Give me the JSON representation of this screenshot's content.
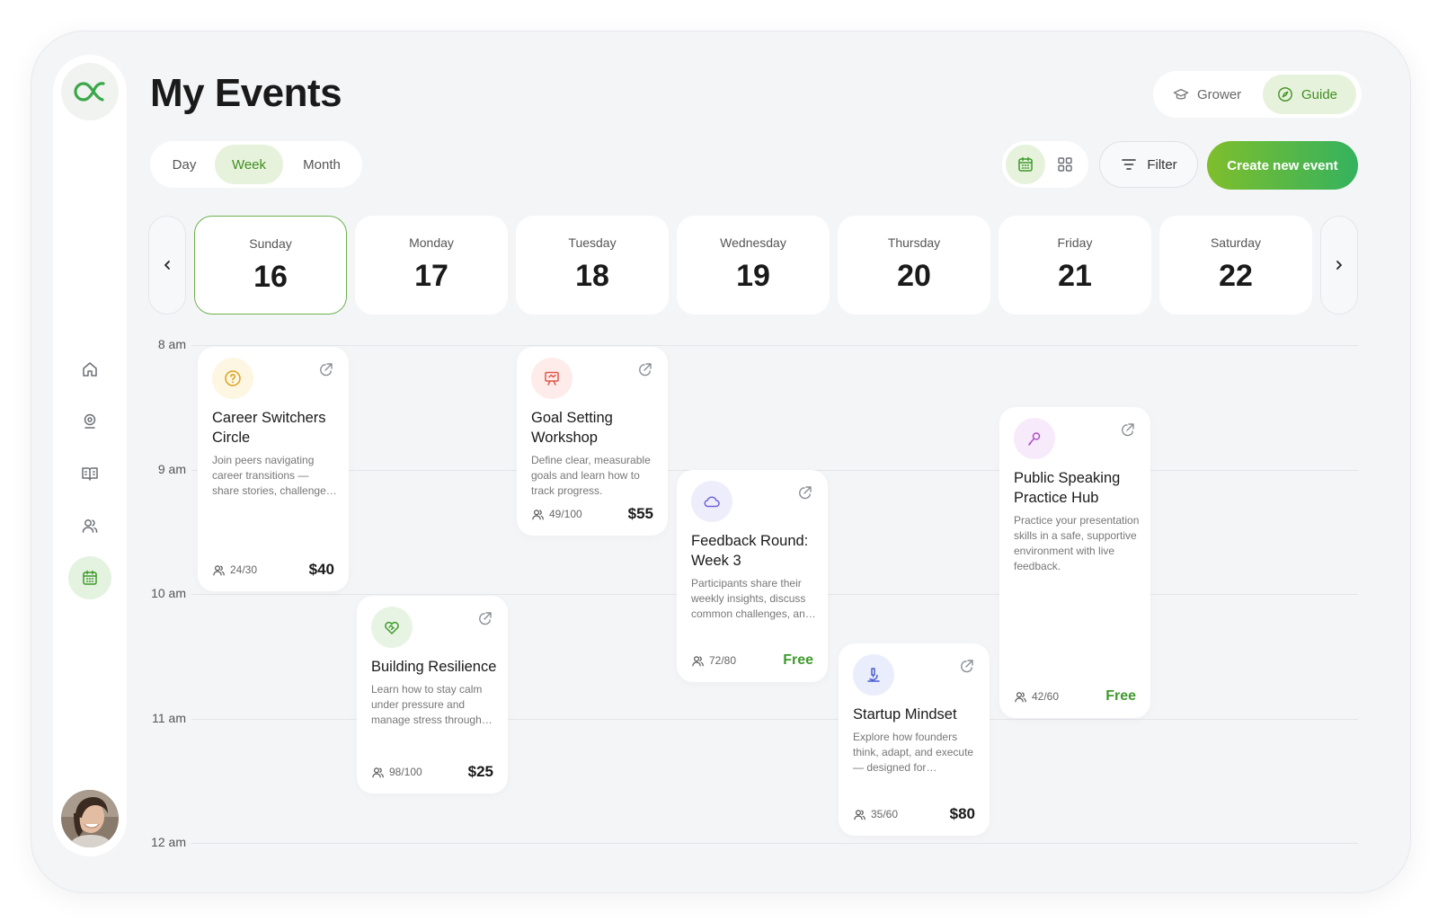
{
  "page": {
    "title": "My Events"
  },
  "roles": [
    {
      "label": "Grower",
      "icon": "graduation-cap-icon",
      "active": false
    },
    {
      "label": "Guide",
      "icon": "compass-icon",
      "active": true
    }
  ],
  "view_tabs": [
    {
      "label": "Day",
      "active": false
    },
    {
      "label": "Week",
      "active": true
    },
    {
      "label": "Month",
      "active": false
    }
  ],
  "layout_toggle": {
    "active": "calendar",
    "options": [
      "calendar-icon",
      "grid-icon"
    ]
  },
  "toolbar": {
    "filter_label": "Filter",
    "create_label": "Create new event"
  },
  "week": {
    "days": [
      {
        "name": "Sunday",
        "date": "16",
        "selected": true
      },
      {
        "name": "Monday",
        "date": "17",
        "selected": false
      },
      {
        "name": "Tuesday",
        "date": "18",
        "selected": false
      },
      {
        "name": "Wednesday",
        "date": "19",
        "selected": false
      },
      {
        "name": "Thursday",
        "date": "20",
        "selected": false
      },
      {
        "name": "Friday",
        "date": "21",
        "selected": false
      },
      {
        "name": "Saturday",
        "date": "22",
        "selected": false
      }
    ]
  },
  "time_labels": [
    "8 am",
    "9 am",
    "10 am",
    "11 am",
    "12 am"
  ],
  "events": [
    {
      "title": "Career Switchers Circle",
      "description": "Join peers navigating career transitions — share stories, challenges and strategies.",
      "attendees": "24/30",
      "price": "$40",
      "icon": "question-circle-icon",
      "icon_color": "#d9a21b",
      "icon_bg": "#fdf6e3"
    },
    {
      "title": "Goal Setting Workshop",
      "description": "Define clear, measurable goals and learn how to track progress.",
      "attendees": "49/100",
      "price": "$55",
      "icon": "presentation-board-icon",
      "icon_color": "#e0564a",
      "icon_bg": "#fdecea"
    },
    {
      "title": "Building Resilience",
      "description": "Learn how to stay calm under pressure and manage stress through practice.",
      "attendees": "98/100",
      "price": "$25",
      "icon": "heart-handshake-icon",
      "icon_color": "#3f9a2c",
      "icon_bg": "#e8f4e3"
    },
    {
      "title": "Feedback Round: Week 3",
      "description": "Participants share their weekly insights, discuss common challenges, and grow.",
      "attendees": "72/80",
      "price": "Free",
      "icon": "cloud-icon",
      "icon_color": "#6d63d6",
      "icon_bg": "#eeedfb"
    },
    {
      "title": "Startup Mindset",
      "description": "Explore how founders think, adapt, and execute — designed for beginners.",
      "attendees": "35/60",
      "price": "$80",
      "icon": "microscope-icon",
      "icon_color": "#4a5fd1",
      "icon_bg": "#eaedfb"
    },
    {
      "title": "Public Speaking Practice Hub",
      "description": "Practice your presentation skills in a safe, supportive environment with live feedback.",
      "attendees": "42/60",
      "price": "Free",
      "icon": "microphone-icon",
      "icon_color": "#b14fc7",
      "icon_bg": "#f7eafa"
    }
  ],
  "sidebar": {
    "items": [
      {
        "icon": "home-icon",
        "active": false
      },
      {
        "icon": "location-pin-icon",
        "active": false
      },
      {
        "icon": "book-open-icon",
        "active": false
      },
      {
        "icon": "users-icon",
        "active": false
      },
      {
        "icon": "calendar-icon",
        "active": true
      }
    ]
  },
  "colors": {
    "accent": "#3f9a2c",
    "accent_bg": "#e6f2dc",
    "button_gradient_start": "#7fbe2c",
    "button_gradient_end": "#34b25e"
  }
}
